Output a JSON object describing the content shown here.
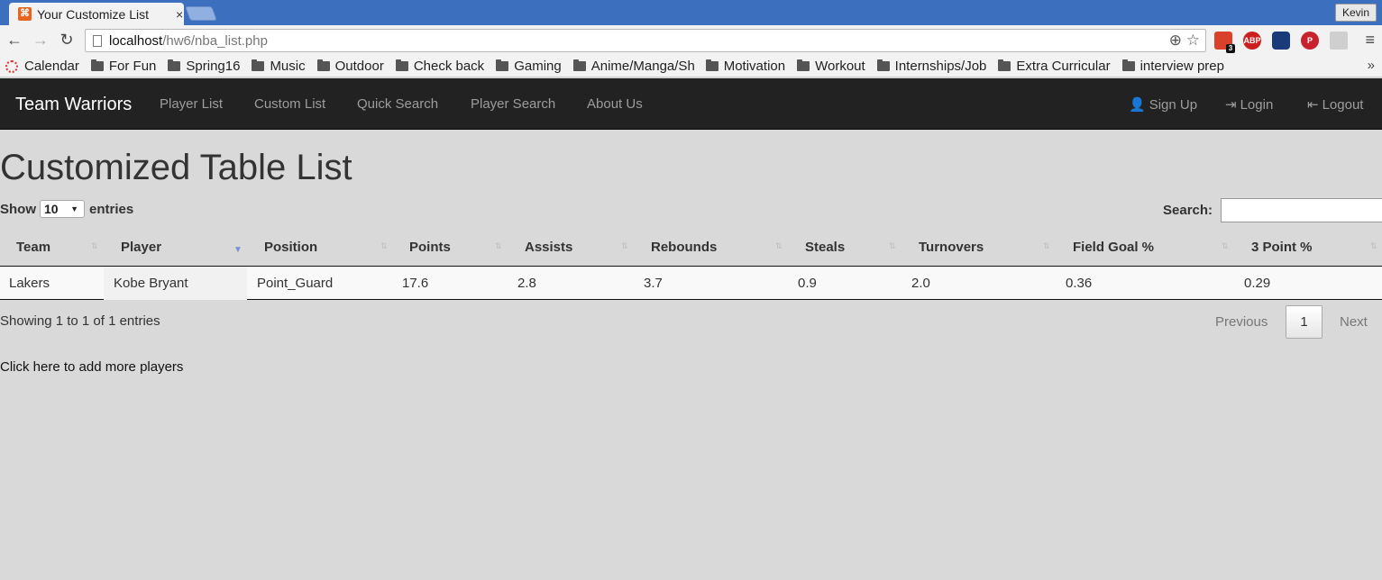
{
  "browser": {
    "tab_title": "Your Customize List",
    "tab_close": "×",
    "user_name": "Kevin",
    "url_host": "localhost",
    "url_path": "/hw6/nba_list.php",
    "todoist_badge": "3",
    "abp_label": "ABP",
    "bookmarks": [
      "Calendar",
      "For Fun",
      "Spring16",
      "Music",
      "Outdoor",
      "Check back",
      "Gaming",
      "Anime/Manga/Sh",
      "Motivation",
      "Workout",
      "Internships/Job",
      "Extra Curricular",
      "interview prep"
    ],
    "bookmarks_more": "»"
  },
  "navbar": {
    "brand": "Team Warriors",
    "links": [
      "Player List",
      "Custom List",
      "Quick Search",
      "Player Search",
      "About Us"
    ],
    "sign_up": "Sign Up",
    "login": "Login",
    "logout": "Logout"
  },
  "main": {
    "title": "Customized Table List",
    "show_label": "Show",
    "entries_label": "entries",
    "length_value": "10",
    "search_label": "Search:",
    "search_value": "",
    "columns": [
      "Team",
      "Player",
      "Position",
      "Points",
      "Assists",
      "Rebounds",
      "Steals",
      "Turnovers",
      "Field Goal %",
      "3 Point %"
    ],
    "rows": [
      [
        "Lakers",
        "Kobe Bryant",
        "Point_Guard",
        "17.6",
        "2.8",
        "3.7",
        "0.9",
        "2.0",
        "0.36",
        "0.29"
      ]
    ],
    "info": "Showing 1 to 1 of 1 entries",
    "pagination": {
      "previous": "Previous",
      "page": "1",
      "next": "Next"
    },
    "add_link": "Click here to add more players"
  }
}
